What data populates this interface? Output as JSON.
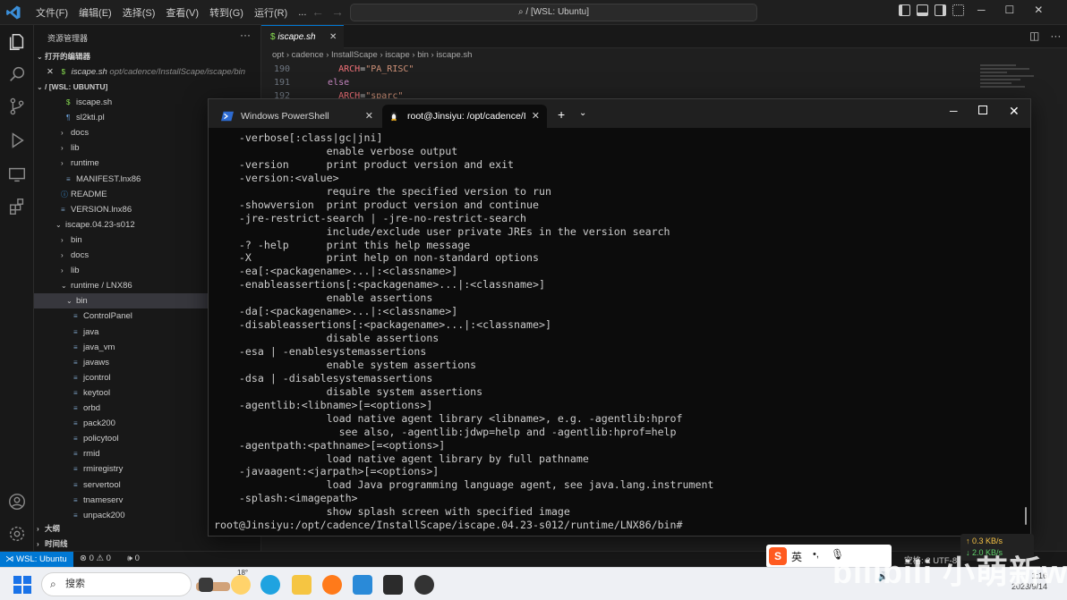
{
  "vscode": {
    "menu": [
      "文件(F)",
      "编辑(E)",
      "选择(S)",
      "查看(V)",
      "转到(G)",
      "运行(R)",
      "..."
    ],
    "command_center": "/ [WSL: Ubuntu]",
    "sidebar": {
      "title": "资源管理器",
      "open_editors_label": "打开的编辑器",
      "open_editor": {
        "name": "iscape.sh",
        "path": "opt/cadence/InstallScape/iscape/bin"
      },
      "root_label": "/ [WSL: UBUNTU]",
      "items": [
        {
          "label": "iscape.sh",
          "kind": "file-sh"
        },
        {
          "label": "sl2kti.pl",
          "kind": "file-pl"
        },
        {
          "label": "docs",
          "kind": "folder"
        },
        {
          "label": "lib",
          "kind": "folder"
        },
        {
          "label": "runtime",
          "kind": "folder"
        },
        {
          "label": "MANIFEST.lnx86",
          "kind": "file"
        },
        {
          "label": "README",
          "kind": "file-info"
        },
        {
          "label": "VERSION.lnx86",
          "kind": "file"
        },
        {
          "label": "iscape.04.23-s012",
          "kind": "folder-open"
        },
        {
          "label": "bin",
          "kind": "folder"
        },
        {
          "label": "docs",
          "kind": "folder"
        },
        {
          "label": "lib",
          "kind": "folder"
        },
        {
          "label": "runtime / LNX86",
          "kind": "folder-open"
        },
        {
          "label": "bin",
          "kind": "folder-open"
        },
        {
          "label": "ControlPanel",
          "kind": "file"
        },
        {
          "label": "java",
          "kind": "file"
        },
        {
          "label": "java_vm",
          "kind": "file"
        },
        {
          "label": "javaws",
          "kind": "file"
        },
        {
          "label": "jcontrol",
          "kind": "file"
        },
        {
          "label": "keytool",
          "kind": "file"
        },
        {
          "label": "orbd",
          "kind": "file"
        },
        {
          "label": "pack200",
          "kind": "file"
        },
        {
          "label": "policytool",
          "kind": "file"
        },
        {
          "label": "rmid",
          "kind": "file"
        },
        {
          "label": "rmiregistry",
          "kind": "file"
        },
        {
          "label": "servertool",
          "kind": "file"
        },
        {
          "label": "tnameserv",
          "kind": "file"
        },
        {
          "label": "unpack200",
          "kind": "file"
        }
      ],
      "bottom_sections": [
        "大纲",
        "时间线"
      ]
    },
    "editor": {
      "tab_label": "iscape.sh",
      "breadcrumb": [
        "opt",
        "cadence",
        "InstallScape",
        "iscape",
        "bin",
        "iscape.sh"
      ],
      "lines": [
        {
          "num": "190",
          "indent": "    ",
          "tokens": [
            {
              "t": "ARCH",
              "c": "var"
            },
            {
              "t": "=",
              "c": "plain"
            },
            {
              "t": "\"PA_RISC\"",
              "c": "str"
            }
          ]
        },
        {
          "num": "191",
          "indent": "  ",
          "tokens": [
            {
              "t": "else",
              "c": "kw"
            }
          ]
        },
        {
          "num": "192",
          "indent": "    ",
          "tokens": [
            {
              "t": "ARCH",
              "c": "var"
            },
            {
              "t": "=",
              "c": "plain"
            },
            {
              "t": "\"sparc\"",
              "c": "str"
            }
          ]
        }
      ]
    },
    "status": {
      "remote": "WSL: Ubuntu",
      "errors": "⊗ 0 ⚠ 0",
      "ports": "🕪 0",
      "right": "空格: 2   UTF-8"
    }
  },
  "terminal": {
    "tabs": [
      {
        "label": "Windows PowerShell"
      },
      {
        "label": "root@Jinsiyu: /opt/cadence/I"
      }
    ],
    "lines": [
      "    -verbose[:class|gc|jni]",
      "                  enable verbose output",
      "    -version      print product version and exit",
      "    -version:<value>",
      "                  require the specified version to run",
      "    -showversion  print product version and continue",
      "    -jre-restrict-search | -jre-no-restrict-search",
      "                  include/exclude user private JREs in the version search",
      "    -? -help      print this help message",
      "    -X            print help on non-standard options",
      "    -ea[:<packagename>...|:<classname>]",
      "    -enableassertions[:<packagename>...|:<classname>]",
      "                  enable assertions",
      "    -da[:<packagename>...|:<classname>]",
      "    -disableassertions[:<packagename>...|:<classname>]",
      "                  disable assertions",
      "    -esa | -enablesystemassertions",
      "                  enable system assertions",
      "    -dsa | -disablesystemassertions",
      "                  disable system assertions",
      "    -agentlib:<libname>[=<options>]",
      "                  load native agent library <libname>, e.g. -agentlib:hprof",
      "                    see also, -agentlib:jdwp=help and -agentlib:hprof=help",
      "    -agentpath:<pathname>[=<options>]",
      "                  load native agent library by full pathname",
      "    -javaagent:<jarpath>[=<options>]",
      "                  load Java programming language agent, see java.lang.instrument",
      "    -splash:<imagepath>",
      "                  show splash screen with specified image",
      "root@Jinsiyu:/opt/cadence/InstallScape/iscape.04.23-s012/runtime/LNX86/bin#"
    ]
  },
  "taskbar": {
    "search_placeholder": "搜索",
    "weather_temp": "18°",
    "clock_time": "1:16",
    "clock_date": "2023/9/14"
  },
  "overlays": {
    "net_up": "↑ 0.3 KB/s",
    "net_down": "↓ 2.0 KB/s",
    "ime_logo": "S",
    "ime_lang": "英",
    "watermark": "bilibili 小萌新wal"
  },
  "colors": {
    "vscode_accent": "#0078d4",
    "terminal_bg": "#0c0c0c",
    "taskbar_bg": "#eef0f4"
  }
}
